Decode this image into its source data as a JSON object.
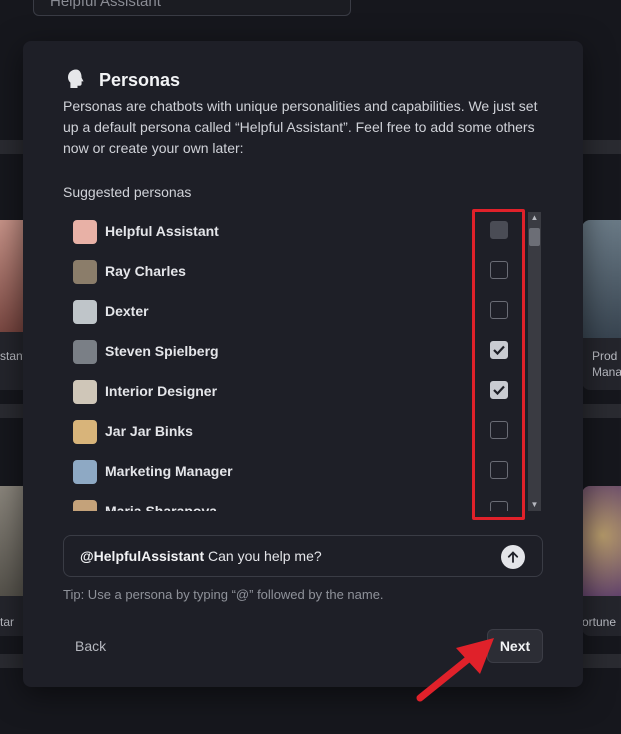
{
  "background": {
    "search_value": "Helpful Assistant",
    "cards": [
      {
        "caption": "stant"
      },
      {
        "caption": "Prod\nMana"
      },
      {
        "caption": "tar"
      },
      {
        "caption": "ortune"
      }
    ]
  },
  "modal": {
    "title": "Personas",
    "icon": "head-silhouette-icon",
    "description": "Personas are chatbots with unique personalities and capabilities. We just set up a default persona called “Helpful Assistant”. Feel free to add some others now or create your own later:",
    "suggested_label": "Suggested personas",
    "personas": [
      {
        "name": "Helpful Assistant",
        "state": "disabled",
        "avatar_color": "#e8b1a6"
      },
      {
        "name": "Ray Charles",
        "state": "unchecked",
        "avatar_color": "#8b7d6a"
      },
      {
        "name": "Dexter",
        "state": "unchecked",
        "avatar_color": "#bfc5c9"
      },
      {
        "name": "Steven Spielberg",
        "state": "checked",
        "avatar_color": "#7a7f86"
      },
      {
        "name": "Interior Designer",
        "state": "checked",
        "avatar_color": "#cfc6b8"
      },
      {
        "name": "Jar Jar Binks",
        "state": "unchecked",
        "avatar_color": "#d8b47a"
      },
      {
        "name": "Marketing Manager",
        "state": "unchecked",
        "avatar_color": "#8ea9c4"
      },
      {
        "name": "Maria Sharapova",
        "state": "unchecked",
        "avatar_color": "#c4a27a"
      }
    ],
    "chat_mention": "@HelpfulAssistant",
    "chat_text": " Can you help me?",
    "tip": "Tip: Use a persona by typing “@” followed by the name.",
    "back_label": "Back",
    "next_label": "Next"
  },
  "colors": {
    "highlight": "#e0212a",
    "modal_bg": "#1e1f27"
  }
}
